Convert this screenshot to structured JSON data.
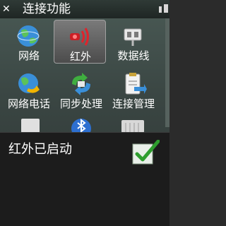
{
  "title_bar": {
    "title": "连接功能",
    "close_symbol": "✕"
  },
  "grid": {
    "items": [
      {
        "label": "网络",
        "icon": "globe-icon"
      },
      {
        "label": "红外",
        "icon": "infrared-icon",
        "selected": true
      },
      {
        "label": "数据线",
        "icon": "usb-cable-icon"
      },
      {
        "label": "网络电话",
        "icon": "voip-globe-icon"
      },
      {
        "label": "同步处理",
        "icon": "sync-arrows-icon"
      },
      {
        "label": "连接管理",
        "icon": "clipboard-manager-icon"
      }
    ],
    "partial_row_icons": [
      "device-icon",
      "bluetooth-icon",
      "keyboard-icon"
    ]
  },
  "dialog": {
    "message": "红外已启动",
    "icon": "checkmark-icon"
  },
  "colors": {
    "accent_red": "#e0232b",
    "check_green": "#2e9e2e",
    "dialog_bg": "#1c1c1c"
  }
}
